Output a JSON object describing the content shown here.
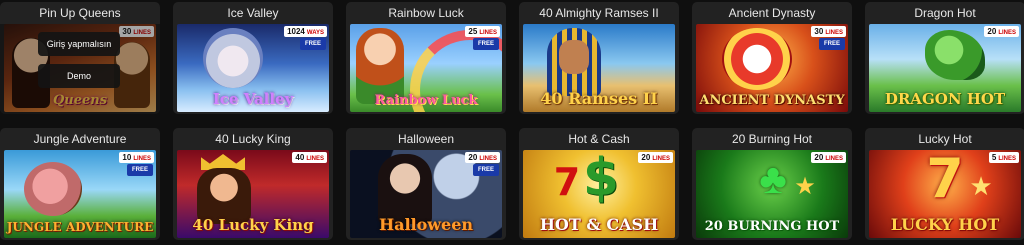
{
  "games": [
    {
      "title": "Pin Up Queens",
      "lines": "30",
      "lines_label": "LINES",
      "free": "",
      "logo": "Queens"
    },
    {
      "title": "Ice Valley",
      "lines": "1024",
      "lines_label": "WAYS",
      "free": "FREE",
      "logo": "Ice Valley"
    },
    {
      "title": "Rainbow Luck",
      "lines": "25",
      "lines_label": "LINES",
      "free": "FREE",
      "logo": "Rainbow Luck"
    },
    {
      "title": "40 Almighty Ramses II",
      "lines": "",
      "lines_label": "",
      "free": "",
      "logo": "40 Ramses II"
    },
    {
      "title": "Ancient Dynasty",
      "lines": "30",
      "lines_label": "LINES",
      "free": "FREE",
      "logo": "ANCIENT DYNASTY"
    },
    {
      "title": "Dragon Hot",
      "lines": "20",
      "lines_label": "LINES",
      "free": "",
      "logo": "DRAGON HOT"
    },
    {
      "title": "Jungle Adventure",
      "lines": "10",
      "lines_label": "LINES",
      "free": "FREE",
      "logo": "JUNGLE ADVENTURE"
    },
    {
      "title": "40 Lucky King",
      "lines": "40",
      "lines_label": "LINES",
      "free": "",
      "logo": "40 Lucky King"
    },
    {
      "title": "Halloween",
      "lines": "20",
      "lines_label": "LINES",
      "free": "FREE",
      "logo": "Halloween"
    },
    {
      "title": "Hot & Cash",
      "lines": "20",
      "lines_label": "LINES",
      "free": "",
      "logo": "HOT & CASH"
    },
    {
      "title": "20 Burning Hot",
      "lines": "20",
      "lines_label": "LINES",
      "free": "",
      "logo": "20 BURNING HOT"
    },
    {
      "title": "Lucky Hot",
      "lines": "5",
      "lines_label": "LINES",
      "free": "",
      "logo": "LUCKY HOT"
    }
  ],
  "hover": {
    "play_label": "Giriş yapmalısın",
    "demo_label": "Demo"
  },
  "colors": {
    "card_bg": "#222222",
    "page_bg": "#0f0f0f",
    "title_text": "#e8e8e8"
  }
}
